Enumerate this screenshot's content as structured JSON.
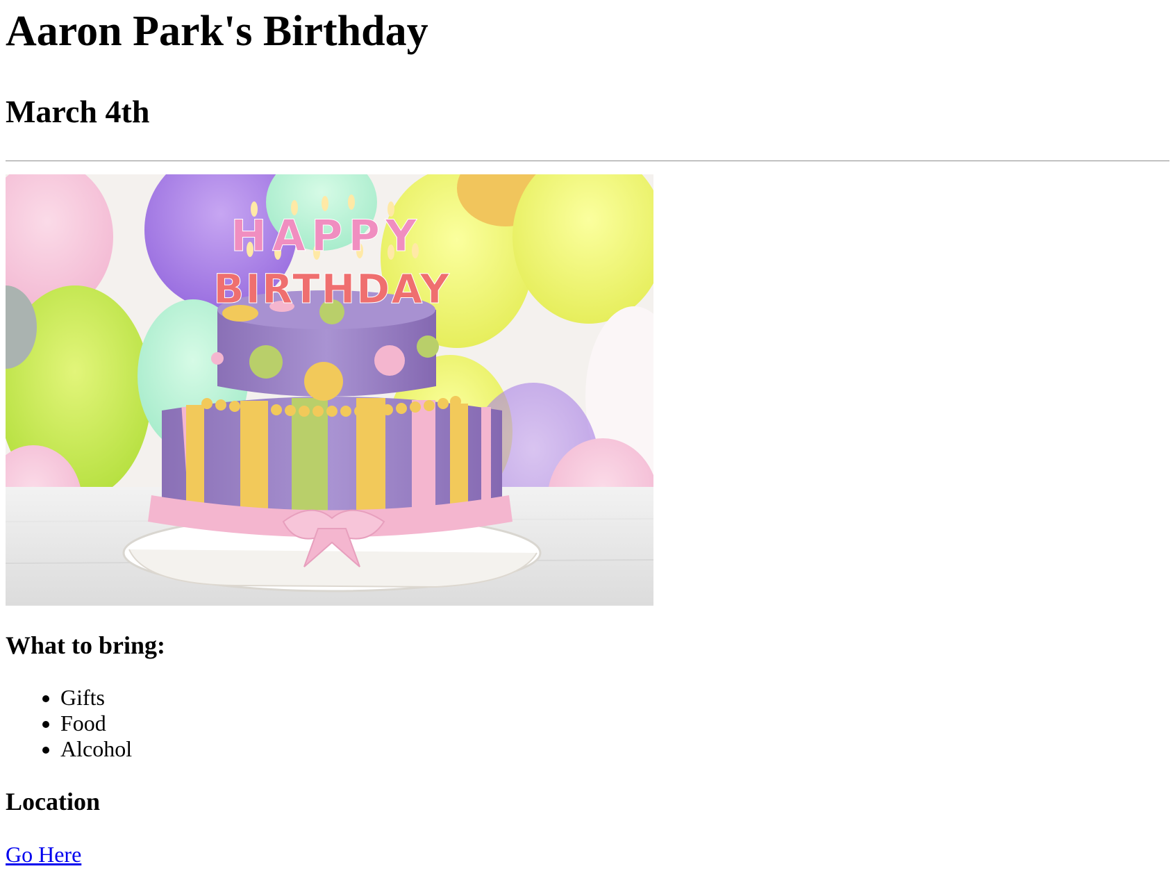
{
  "title": "Aaron Park's Birthday",
  "date": "March 4th",
  "bring_heading": "What to bring:",
  "bring_items": [
    "Gifts",
    "Food",
    "Alcohol"
  ],
  "location_heading": "Location",
  "location_link": "Go Here",
  "image": {
    "candle_letters_top": "HAPPY",
    "candle_letters_bottom": "BIRTHDAY",
    "colors": {
      "cake_purple": "#9c86c6",
      "stripe_yellow": "#f2c95a",
      "stripe_green": "#b9cf6a",
      "ribbon_pink": "#f4b6cf"
    }
  }
}
